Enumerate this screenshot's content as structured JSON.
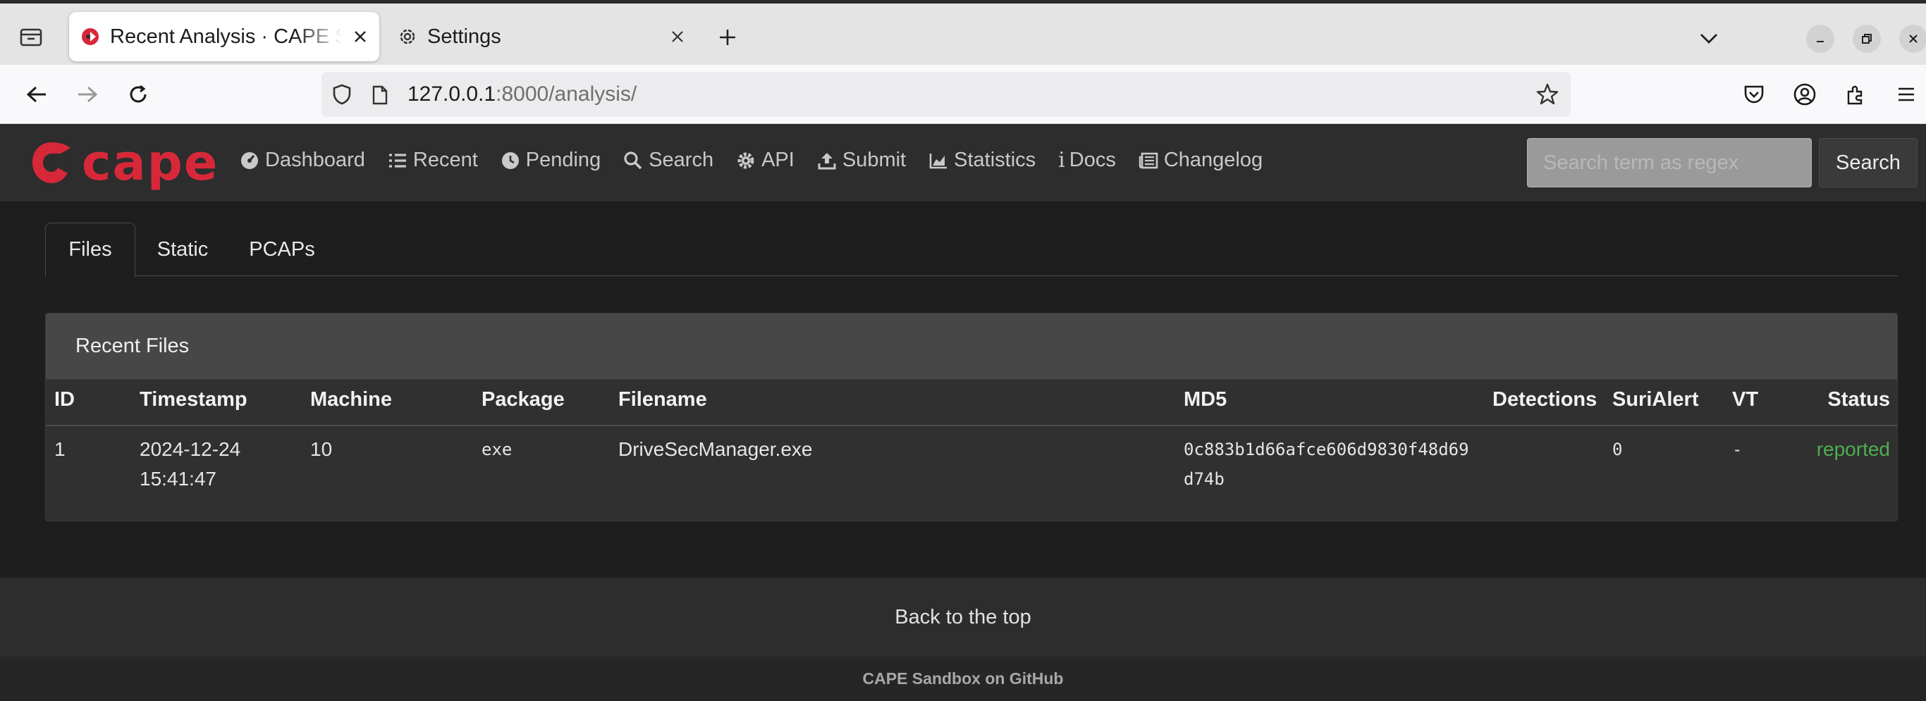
{
  "browser": {
    "tabs": [
      {
        "title": "Recent Analysis · CAPE Sandbox",
        "icon": "cape-favicon",
        "active": true
      },
      {
        "title": "Settings",
        "icon": "gear-icon",
        "active": false
      }
    ],
    "url_host": "127.0.0.1",
    "url_rest": ":8000/analysis/"
  },
  "app": {
    "logo_text": "cape",
    "brand_color": "#d7283a",
    "menu": [
      {
        "label": "Dashboard",
        "icon": "dashboard-icon"
      },
      {
        "label": "Recent",
        "icon": "list-icon"
      },
      {
        "label": "Pending",
        "icon": "clock-icon"
      },
      {
        "label": "Search",
        "icon": "search-icon"
      },
      {
        "label": "API",
        "icon": "gear-icon"
      },
      {
        "label": "Submit",
        "icon": "upload-icon"
      },
      {
        "label": "Statistics",
        "icon": "area-chart-icon"
      },
      {
        "label": "Docs",
        "icon": "info-icon"
      },
      {
        "label": "Changelog",
        "icon": "newspaper-icon"
      }
    ],
    "search": {
      "placeholder": "Search term as regex",
      "button": "Search"
    }
  },
  "content_tabs": [
    "Files",
    "Static",
    "PCAPs"
  ],
  "recent_files": {
    "title": "Recent Files",
    "columns": [
      "ID",
      "Timestamp",
      "Machine",
      "Package",
      "Filename",
      "MD5",
      "Detections",
      "SuriAlert",
      "VT",
      "Status"
    ],
    "rows": [
      {
        "id": "1",
        "timestamp_date": "2024-12-24",
        "timestamp_time": "15:41:47",
        "machine": "10",
        "package": "exe",
        "filename": "DriveSecManager.exe",
        "md5_line1": "0c883b1d66afce606d9830f48d69",
        "md5_line2": "d74b",
        "detections": "",
        "surialert": "0",
        "vt": "-",
        "status": "reported",
        "status_color": "#4caf50"
      }
    ]
  },
  "footer": {
    "back_to_top": "Back to the top",
    "github": "CAPE Sandbox on GitHub"
  }
}
